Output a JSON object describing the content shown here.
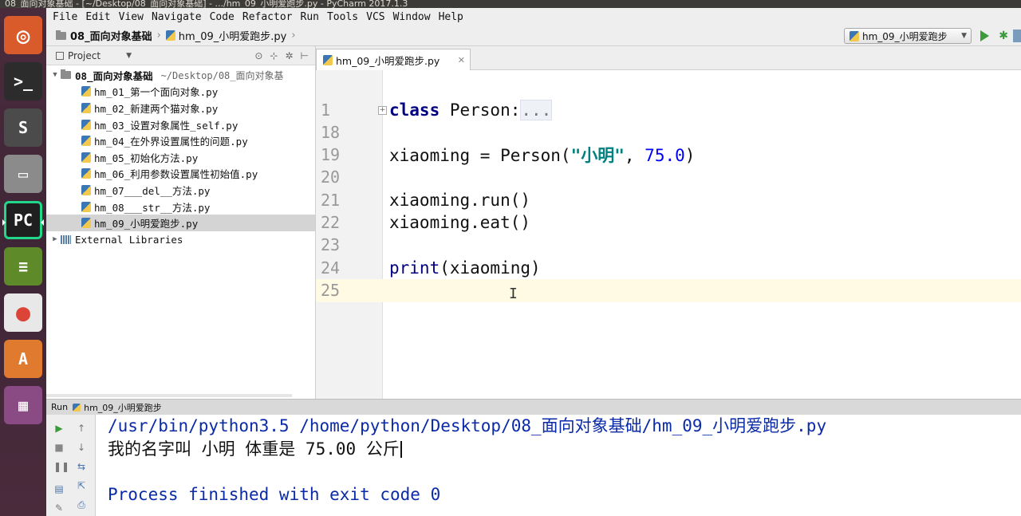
{
  "window": {
    "title": "08_面向对象基础 - [~/Desktop/08_面向对象基础] - .../hm_09_小明爱跑步.py - PyCharm 2017.1.3"
  },
  "launcher": {
    "items": [
      {
        "name": "ubuntu-dash-icon",
        "glyph": "◎",
        "bg": "#d95a2b"
      },
      {
        "name": "terminal-icon",
        "glyph": ">_",
        "bg": "#2c2c2c"
      },
      {
        "name": "sublime-text-icon",
        "glyph": "S",
        "bg": "#4b4b4b"
      },
      {
        "name": "files-icon",
        "glyph": "▭",
        "bg": "#8b8b8b"
      },
      {
        "name": "pycharm-icon",
        "glyph": "PC",
        "bg": "#1f1f1f"
      },
      {
        "name": "books-icon",
        "glyph": "≡",
        "bg": "#5e8a2a"
      },
      {
        "name": "chrome-icon",
        "glyph": "●",
        "bg": "#e8e8e8"
      },
      {
        "name": "software-center-icon",
        "glyph": "A",
        "bg": "#e07a2f"
      },
      {
        "name": "workspace-switcher-icon",
        "glyph": "▦",
        "bg": "#8a4a84"
      }
    ]
  },
  "menu": {
    "items": [
      "File",
      "Edit",
      "View",
      "Navigate",
      "Code",
      "Refactor",
      "Run",
      "Tools",
      "VCS",
      "Window",
      "Help"
    ]
  },
  "nav": {
    "crumbs": [
      "08_面向对象基础",
      "hm_09_小明爱跑步.py"
    ],
    "run_config": "hm_09_小明爱跑步"
  },
  "project": {
    "header": "Project",
    "root": {
      "name": "08_面向对象基础",
      "path": "~/Desktop/08_面向对象基"
    },
    "files": [
      "hm_01_第一个面向对象.py",
      "hm_02_新建两个猫对象.py",
      "hm_03_设置对象属性_self.py",
      "hm_04_在外界设置属性的问题.py",
      "hm_05_初始化方法.py",
      "hm_06_利用参数设置属性初始值.py",
      "hm_07___del__方法.py",
      "hm_08___str__方法.py",
      "hm_09_小明爱跑步.py"
    ],
    "selected_index": 8,
    "external": "External Libraries"
  },
  "editor": {
    "tab": "hm_09_小明爱跑步.py",
    "lines": [
      {
        "num": "1",
        "text": "class Person:..."
      },
      {
        "num": "18",
        "text": ""
      },
      {
        "num": "19",
        "text": "xiaoming = Person(\"小明\", 75.0)"
      },
      {
        "num": "20",
        "text": ""
      },
      {
        "num": "21",
        "text": "xiaoming.run()"
      },
      {
        "num": "22",
        "text": "xiaoming.eat()"
      },
      {
        "num": "23",
        "text": ""
      },
      {
        "num": "24",
        "text": "print(xiaoming)"
      },
      {
        "num": "25",
        "text": ""
      }
    ],
    "code": {
      "l1_kw": "class",
      "l1_name": " Person:",
      "l1_fold": "...",
      "l19_a": "xiaoming = Person(",
      "l19_str": "\"小明\"",
      "l19_b": ", ",
      "l19_num": "75.0",
      "l19_c": ")",
      "l21": "xiaoming.run()",
      "l22": "xiaoming.eat()",
      "l24_kw": "print",
      "l24_b": "(xiaoming)"
    },
    "current_line": "25"
  },
  "run": {
    "label": "Run",
    "config": "hm_09_小明爱跑步",
    "console": [
      "/usr/bin/python3.5 /home/python/Desktop/08_面向对象基础/hm_09_小明爱跑步.py",
      "我的名字叫 小明 体重是 75.00 公斤",
      "",
      "Process finished with exit code 0"
    ]
  }
}
